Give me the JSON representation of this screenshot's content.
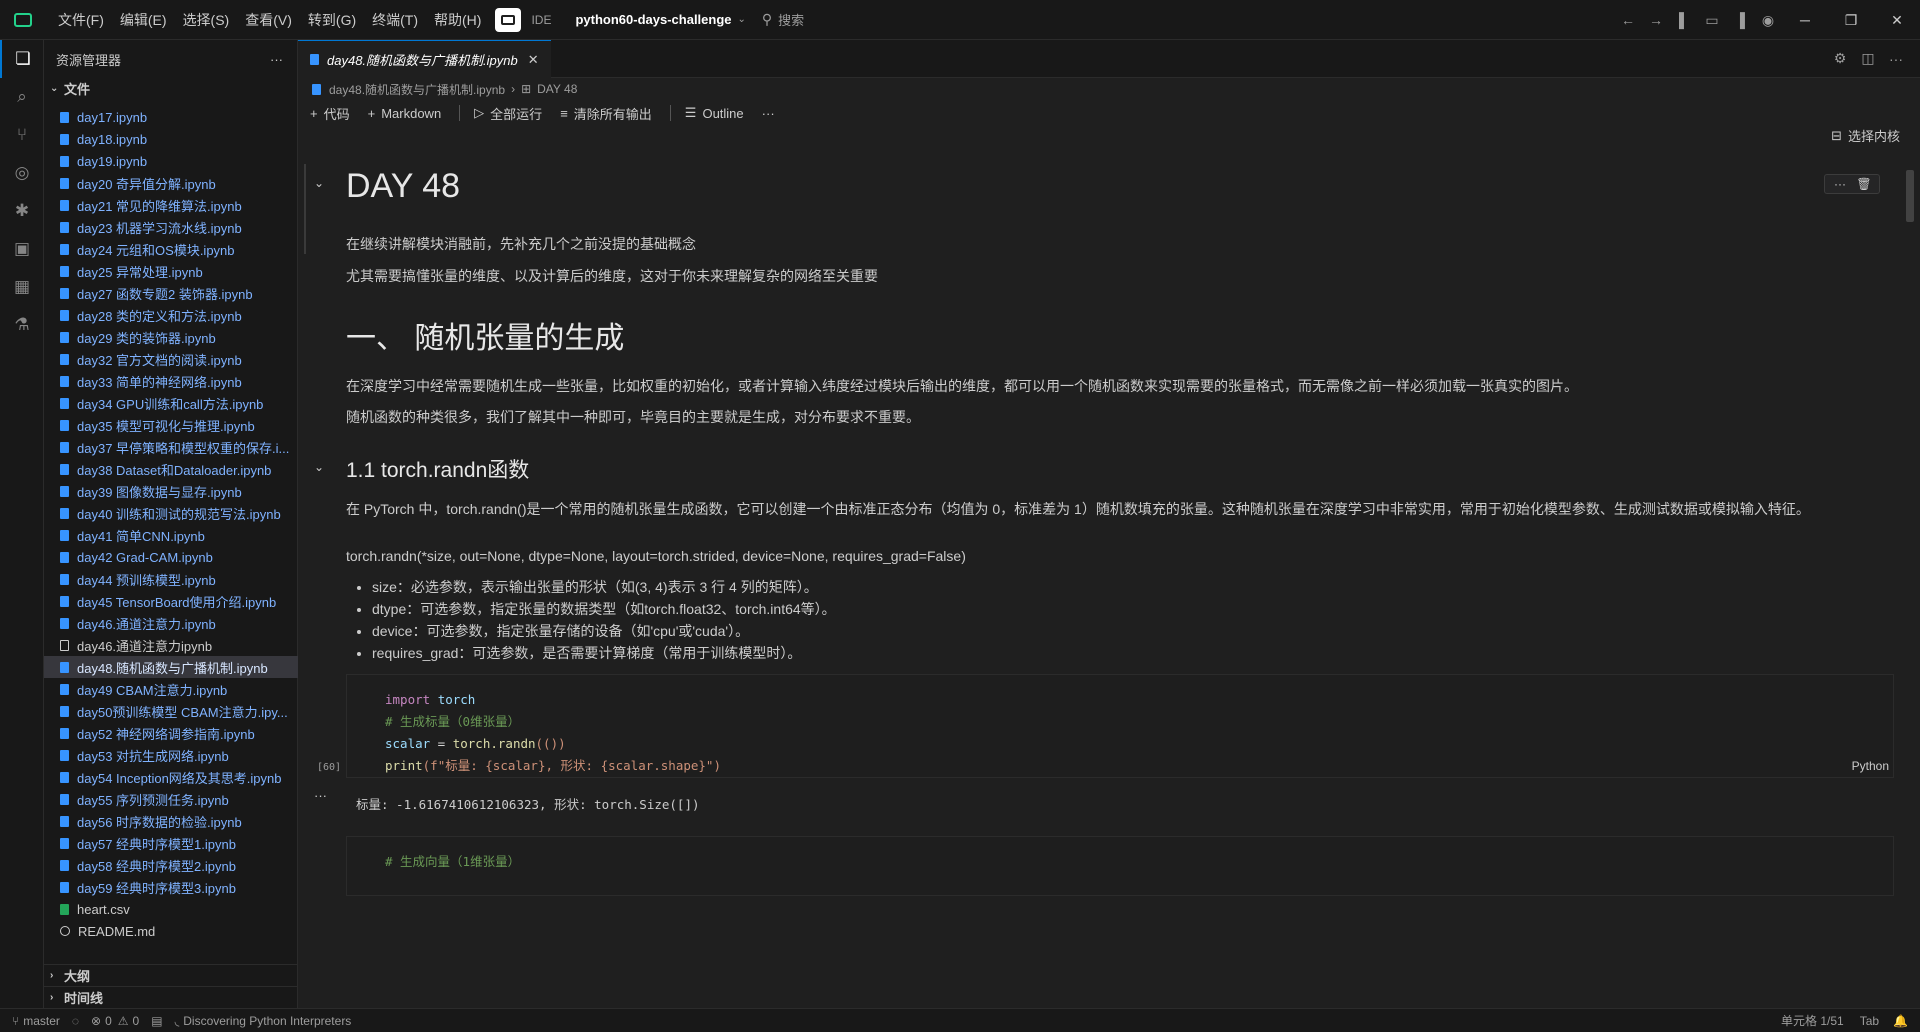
{
  "menu": [
    "文件(F)",
    "编辑(E)",
    "选择(S)",
    "查看(V)",
    "转到(G)",
    "终端(T)",
    "帮助(H)"
  ],
  "ide_label": "IDE",
  "project": "python60-days-challenge",
  "search_placeholder": "搜索",
  "sidebar": {
    "title": "资源管理器",
    "section": "文件",
    "files": [
      {
        "name": "day17.ipynb",
        "kind": "nb"
      },
      {
        "name": "day18.ipynb",
        "kind": "nb"
      },
      {
        "name": "day19.ipynb",
        "kind": "nb"
      },
      {
        "name": "day20 奇异值分解.ipynb",
        "kind": "nb"
      },
      {
        "name": "day21 常见的降维算法.ipynb",
        "kind": "nb"
      },
      {
        "name": "day23 机器学习流水线.ipynb",
        "kind": "nb"
      },
      {
        "name": "day24 元组和OS模块.ipynb",
        "kind": "nb"
      },
      {
        "name": "day25 异常处理.ipynb",
        "kind": "nb"
      },
      {
        "name": "day27 函数专题2 装饰器.ipynb",
        "kind": "nb"
      },
      {
        "name": "day28 类的定义和方法.ipynb",
        "kind": "nb"
      },
      {
        "name": "day29 类的装饰器.ipynb",
        "kind": "nb"
      },
      {
        "name": "day32 官方文档的阅读.ipynb",
        "kind": "nb"
      },
      {
        "name": "day33 简单的神经网络.ipynb",
        "kind": "nb"
      },
      {
        "name": "day34 GPU训练和call方法.ipynb",
        "kind": "nb"
      },
      {
        "name": "day35 模型可视化与推理.ipynb",
        "kind": "nb"
      },
      {
        "name": "day37 早停策略和模型权重的保存.i...",
        "kind": "nb"
      },
      {
        "name": "day38 Dataset和Dataloader.ipynb",
        "kind": "nb"
      },
      {
        "name": "day39 图像数据与显存.ipynb",
        "kind": "nb"
      },
      {
        "name": "day40 训练和测试的规范写法.ipynb",
        "kind": "nb"
      },
      {
        "name": "day41 简单CNN.ipynb",
        "kind": "nb"
      },
      {
        "name": "day42 Grad-CAM.ipynb",
        "kind": "nb"
      },
      {
        "name": "day44 预训练模型.ipynb",
        "kind": "nb"
      },
      {
        "name": "day45 TensorBoard使用介绍.ipynb",
        "kind": "nb"
      },
      {
        "name": "day46.通道注意力.ipynb",
        "kind": "nb"
      },
      {
        "name": "day46.通道注意力ipynb",
        "kind": "plain"
      },
      {
        "name": "day48.随机函数与广播机制.ipynb",
        "kind": "selected"
      },
      {
        "name": "day49 CBAM注意力.ipynb",
        "kind": "nb"
      },
      {
        "name": "day50预训练模型 CBAM注意力.ipy...",
        "kind": "nb"
      },
      {
        "name": "day52 神经网络调参指南.ipynb",
        "kind": "nb"
      },
      {
        "name": "day53 对抗生成网络.ipynb",
        "kind": "nb"
      },
      {
        "name": "day54 Inception网络及其思考.ipynb",
        "kind": "nb"
      },
      {
        "name": "day55 序列预测任务.ipynb",
        "kind": "nb"
      },
      {
        "name": "day56 时序数据的检验.ipynb",
        "kind": "nb"
      },
      {
        "name": "day57 经典时序模型1.ipynb",
        "kind": "nb"
      },
      {
        "name": "day58 经典时序模型2.ipynb",
        "kind": "nb"
      },
      {
        "name": "day59 经典时序模型3.ipynb",
        "kind": "nb"
      },
      {
        "name": "heart.csv",
        "kind": "csv"
      },
      {
        "name": "README.md",
        "kind": "info"
      }
    ],
    "outline_section": "大纲",
    "timeline_section": "时间线"
  },
  "editor": {
    "tab_title": "day48.随机函数与广播机制.ipynb",
    "breadcrumb_file": "day48.随机函数与广播机制.ipynb",
    "breadcrumb_section": "DAY 48",
    "toolbar": {
      "code": "代码",
      "markdown": "Markdown",
      "run_all": "全部运行",
      "clear_outputs": "清除所有输出",
      "outline": "Outline",
      "more": "···"
    },
    "kernel": "选择内核"
  },
  "notebook": {
    "h1": "DAY 48",
    "p1": "在继续讲解模块消融前，先补充几个之前没提的基础概念",
    "p2": "尤其需要搞懂张量的维度、以及计算后的维度，这对于你未来理解复杂的网络至关重要",
    "h2": "一、 随机张量的生成",
    "p3": "在深度学习中经常需要随机生成一些张量，比如权重的初始化，或者计算输入纬度经过模块后输出的维度，都可以用一个随机函数来实现需要的张量格式，而无需像之前一样必须加载一张真实的图片。",
    "p4": "随机函数的种类很多，我们了解其中一种即可，毕竟目的主要就是生成，对分布要求不重要。",
    "h3": "1.1 torch.randn函数",
    "p5": "在 PyTorch 中，torch.randn()是一个常用的随机张量生成函数，它可以创建一个由标准正态分布（均值为 0，标准差为 1）随机数填充的张量。这种随机张量在深度学习中非常实用，常用于初始化模型参数、生成测试数据或模拟输入特征。",
    "signature": "torch.randn(*size, out=None, dtype=None, layout=torch.strided, device=None, requires_grad=False)",
    "bullets": [
      "size：必选参数，表示输出张量的形状（如(3, 4)表示 3 行 4 列的矩阵）。",
      "dtype：可选参数，指定张量的数据类型（如torch.float32、torch.int64等）。",
      "device：可选参数，指定张量存储的设备（如'cpu'或'cuda'）。",
      "requires_grad：可选参数，是否需要计算梯度（常用于训练模型时）。"
    ],
    "code1": {
      "kw_import": "import",
      "mod": "torch",
      "comment": "# 生成标量（0维张量）",
      "var": "scalar",
      "eq": " = ",
      "call": "torch.randn",
      "call_args": "(())",
      "print": "print",
      "fstr": "(f\"标量: {scalar}, 形状: {scalar.shape}\")",
      "exec_count": "[60]",
      "lang": "Python"
    },
    "output1": "标量: -1.6167410612106323, 形状: torch.Size([])",
    "code2_comment": "# 生成向量（1维张量）"
  },
  "statusbar": {
    "branch": "master",
    "errors": "0",
    "warnings": "0",
    "message": "Discovering Python Interpreters",
    "cell": "单元格 1/51",
    "indent": "Tab"
  }
}
